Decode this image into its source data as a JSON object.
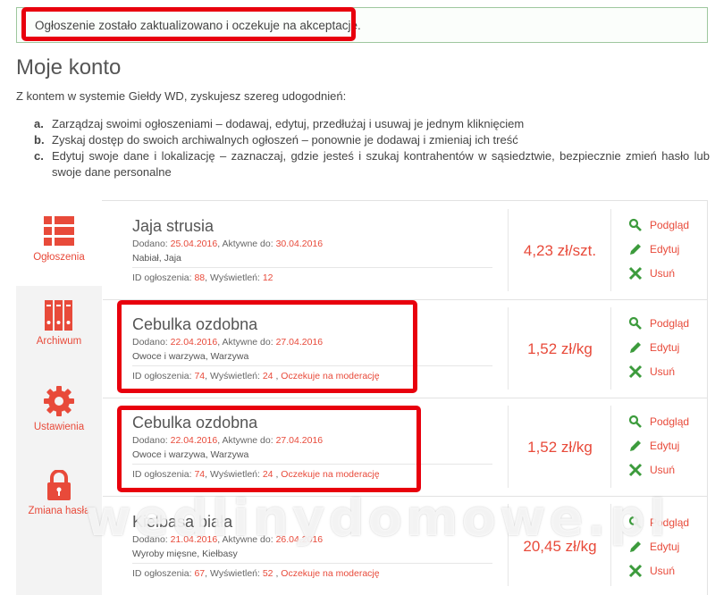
{
  "alert": {
    "message": "Ogłoszenie zostało zaktualizowano i oczekuje na akceptację."
  },
  "page": {
    "title": "Moje konto",
    "intro": "Z kontem w systemie Giełdy WD, zyskujesz szereg udogodnień:",
    "features": [
      {
        "letter": "a.",
        "text": "Zarządzaj swoimi ogłoszeniami – dodawaj, edytuj, przedłużaj i usuwaj je jednym kliknięciem"
      },
      {
        "letter": "b.",
        "text": "Zyskaj dostęp do swoich archiwalnych ogłoszeń – ponownie je dodawaj i zmieniaj ich treść"
      },
      {
        "letter": "c.",
        "text": "Edytuj swoje dane i lokalizację – zaznaczaj, gdzie jesteś i szukaj kontrahentów w sąsiedztwie, bezpiecznie zmień hasło lub swoje dane personalne"
      }
    ]
  },
  "sidebar": {
    "items": [
      {
        "label": "Ogłoszenia",
        "icon": "list-icon"
      },
      {
        "label": "Archiwum",
        "icon": "archive-icon"
      },
      {
        "label": "Ustawienia",
        "icon": "gear-icon"
      },
      {
        "label": "Zmiana hasła",
        "icon": "lock-icon"
      }
    ]
  },
  "labels": {
    "added": "Dodano:",
    "active_until": "Aktywne do:",
    "ad_id": "ID ogłoszenia:",
    "views": "Wyświetleń:",
    "sep": ",",
    "preview": "Podgląd",
    "edit": "Edytuj",
    "delete": "Usuń"
  },
  "listings": [
    {
      "title": "Jaja strusia",
      "added": "25.04.2016",
      "active_until": "30.04.2016",
      "category": "Nabiał, Jaja",
      "id": "88",
      "views": "12",
      "status": "",
      "price": "4,23 zł/szt."
    },
    {
      "title": "Cebulka ozdobna",
      "added": "22.04.2016",
      "active_until": "27.04.2016",
      "category": "Owoce i warzywa, Warzywa",
      "id": "74",
      "views": "24",
      "status": "Oczekuje na moderację",
      "price": "1,52 zł/kg"
    },
    {
      "title": "Cebulka ozdobna",
      "added": "22.04.2016",
      "active_until": "27.04.2016",
      "category": "Owoce i warzywa, Warzywa",
      "id": "74",
      "views": "24",
      "status": "Oczekuje na moderację",
      "price": "1,52 zł/kg"
    },
    {
      "title": "Kiełbasa biała",
      "added": "21.04.2016",
      "active_until": "26.04.2016",
      "category": "Wyroby mięsne, Kiełbasy",
      "id": "67",
      "views": "52",
      "status": "Oczekuje na moderację",
      "price": "20,45 zł/kg"
    }
  ],
  "watermark": "wedlinydomowe.pl",
  "colors": {
    "accent": "#e84a3a",
    "action_icon": "#3c9b3c",
    "highlight": "#e8000d"
  }
}
